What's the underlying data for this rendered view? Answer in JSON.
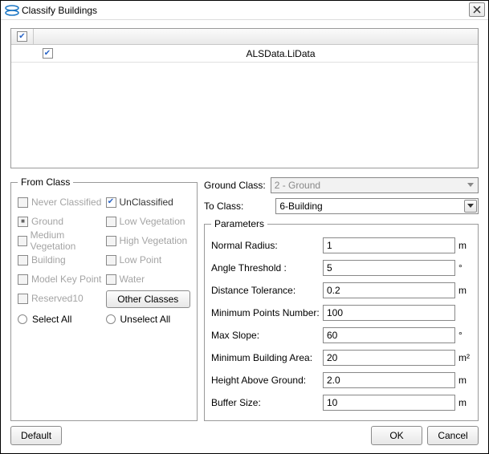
{
  "window": {
    "title": "Classify Buildings"
  },
  "file_list": {
    "header_checked": true,
    "items": [
      {
        "name": "ALSData.LiData",
        "checked": true
      }
    ]
  },
  "from_class": {
    "legend": "From Class",
    "items": {
      "never_classified": {
        "label": "Never Classified",
        "checked": false,
        "enabled": false
      },
      "unclassified": {
        "label": "UnClassified",
        "checked": true,
        "enabled": true
      },
      "ground_item": {
        "label": "Ground",
        "checked": "mixed",
        "enabled": false
      },
      "low_vegetation": {
        "label": "Low Vegetation",
        "checked": false,
        "enabled": false
      },
      "medium_vegetation": {
        "label": "Medium Vegetation",
        "checked": false,
        "enabled": false
      },
      "high_vegetation": {
        "label": "High Vegetation",
        "checked": false,
        "enabled": false
      },
      "building": {
        "label": "Building",
        "checked": false,
        "enabled": false
      },
      "low_point": {
        "label": "Low Point",
        "checked": false,
        "enabled": false
      },
      "model_key_point": {
        "label": "Model Key Point",
        "checked": false,
        "enabled": false
      },
      "water": {
        "label": "Water",
        "checked": false,
        "enabled": false
      },
      "reserved10": {
        "label": "Reserved10",
        "checked": false,
        "enabled": false
      }
    },
    "other_classes_label": "Other Classes",
    "select_all_label": "Select All",
    "unselect_all_label": "Unselect All"
  },
  "ground_class": {
    "label": "Ground  Class:",
    "value": "2 - Ground"
  },
  "to_class": {
    "label": "To Class:",
    "value": "6-Building"
  },
  "parameters": {
    "legend": "Parameters",
    "rows": {
      "normal_radius": {
        "label": "Normal Radius:",
        "value": "1",
        "unit": "m"
      },
      "angle_threshold": {
        "label": "Angle Threshold :",
        "value": "5",
        "unit": "°"
      },
      "distance_tolerance": {
        "label": "Distance Tolerance:",
        "value": "0.2",
        "unit": "m"
      },
      "min_points_number": {
        "label": "Minimum Points Number:",
        "value": "100",
        "unit": ""
      },
      "max_slope": {
        "label": "Max Slope:",
        "value": "60",
        "unit": "°"
      },
      "min_building_area": {
        "label": "Minimum Building Area:",
        "value": "20",
        "unit": "m²"
      },
      "height_above_ground": {
        "label": "Height Above Ground:",
        "value": "2.0",
        "unit": "m"
      },
      "buffer_size": {
        "label": "Buffer Size:",
        "value": "10",
        "unit": "m"
      }
    }
  },
  "buttons": {
    "default": "Default",
    "ok": "OK",
    "cancel": "Cancel"
  }
}
